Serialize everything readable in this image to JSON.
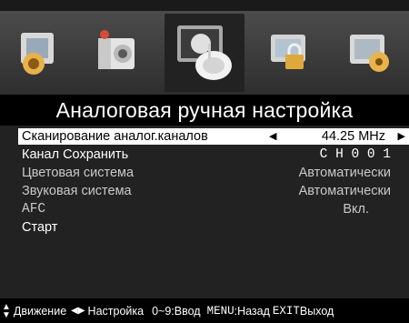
{
  "menu_title": "Аналоговая ручная настройка",
  "icons": [
    "picture-icon",
    "sound-icon",
    "channel-icon",
    "lock-icon",
    "setup-icon"
  ],
  "selected_icon": "channel-icon",
  "items": [
    {
      "label": "Сканирование аналог.каналов",
      "value": "44.25 MHz",
      "selected": true
    },
    {
      "label": "Канал Сохранить",
      "value": "C H 0 0 1"
    },
    {
      "label": "Цветовая система",
      "value": "Автоматически"
    },
    {
      "label": "Звуковая система",
      "value": "Автоматически"
    },
    {
      "label": "AFC",
      "value": "Вкл."
    },
    {
      "label": "Старт",
      "value": ""
    }
  ],
  "footer": {
    "move": "Движение",
    "adjust": "Настройка",
    "input": "0~9:Ввод",
    "menu_key": "MENU",
    "menu_action": ":Назад",
    "exit_key": "EXIT",
    "exit_action": "Выход"
  }
}
